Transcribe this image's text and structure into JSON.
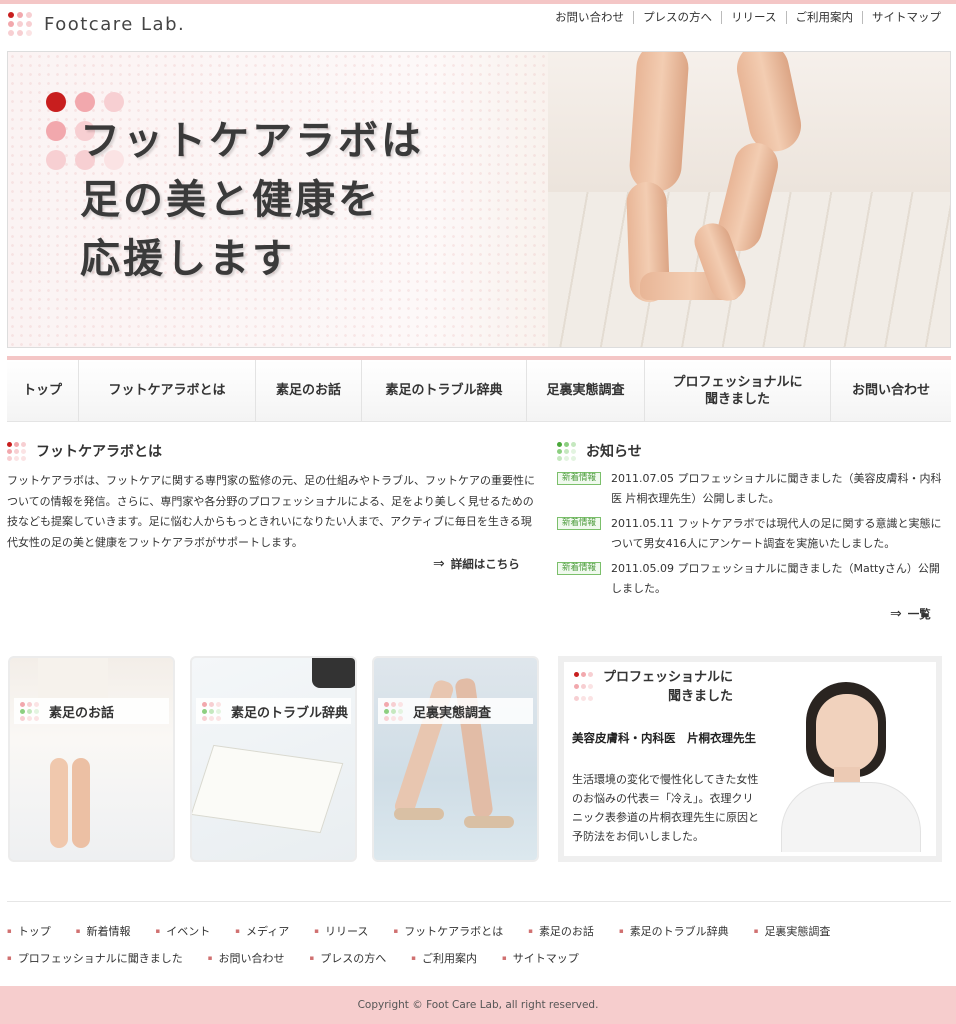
{
  "colors": {
    "accent_pink": "#f4c6c6",
    "dot_red": "#c81e1e",
    "dot_pink": "#f2a8ad",
    "dot_light": "#f7cfd2",
    "dot_green": "#8ccf80",
    "footer_bg": "#f6cdcd"
  },
  "header": {
    "logo": "Footcare Lab.",
    "util_links": [
      "お問い合わせ",
      "プレスの方へ",
      "リリース",
      "ご利用案内",
      "サイトマップ"
    ]
  },
  "hero": {
    "lines": [
      "フットケアラボは",
      "足の美と健康を",
      "応援します"
    ]
  },
  "nav": [
    "トップ",
    "フットケアラボとは",
    "素足のお話",
    "素足のトラブル辞典",
    "足裏実態調査",
    "プロフェッショナルに\n聞きました",
    "お問い合わせ"
  ],
  "about": {
    "title": "フットケアラボとは",
    "text": "フットケアラボは、フットケアに関する専門家の監修の元、足の仕組みやトラブル、フットケアの重要性についての情報を発信。さらに、専門家や各分野のプロフェッショナルによる、足をより美しく見せるための技なども提案していきます。足に悩む人からもっときれいになりたい人まで、アクティブに毎日を生きる現代女性の足の美と健康をフットケアラボがサポートします。",
    "more": "詳細はこちら"
  },
  "news": {
    "title": "お知らせ",
    "badge": "新着情報",
    "items": [
      "2011.07.05  プロフェッショナルに聞きました（美容皮膚科・内科医 片桐衣理先生）公開しました。",
      "2011.05.11  フットケアラボでは現代人の足に関する意識と実態について男女416人にアンケート調査を実施いたしました。",
      "2011.05.09  プロフェッショナルに聞きました（Mattyさん）公開しました。"
    ],
    "more": "一覧"
  },
  "banners": [
    "素足のお話",
    "素足のトラブル辞典",
    "足裏実態調査"
  ],
  "pro": {
    "title": "プロフェッショナルに\n聞きました",
    "name": "美容皮膚科・内科医　片桐衣理先生",
    "desc": "生活環境の変化で慢性化してきた女性のお悩みの代表＝「冷え」。衣理クリニック表参道の片桐衣理先生に原因と予防法をお伺いしました。"
  },
  "footer": {
    "links": [
      "トップ",
      "新着情報",
      "イベント",
      "メディア",
      "リリース",
      "フットケアラボとは",
      "素足のお話",
      "素足のトラブル辞典",
      "足裏実態調査",
      "プロフェッショナルに聞きました",
      "お問い合わせ",
      "プレスの方へ",
      "ご利用案内",
      "サイトマップ"
    ],
    "copyright": "Copyright © Foot Care Lab, all right reserved."
  }
}
